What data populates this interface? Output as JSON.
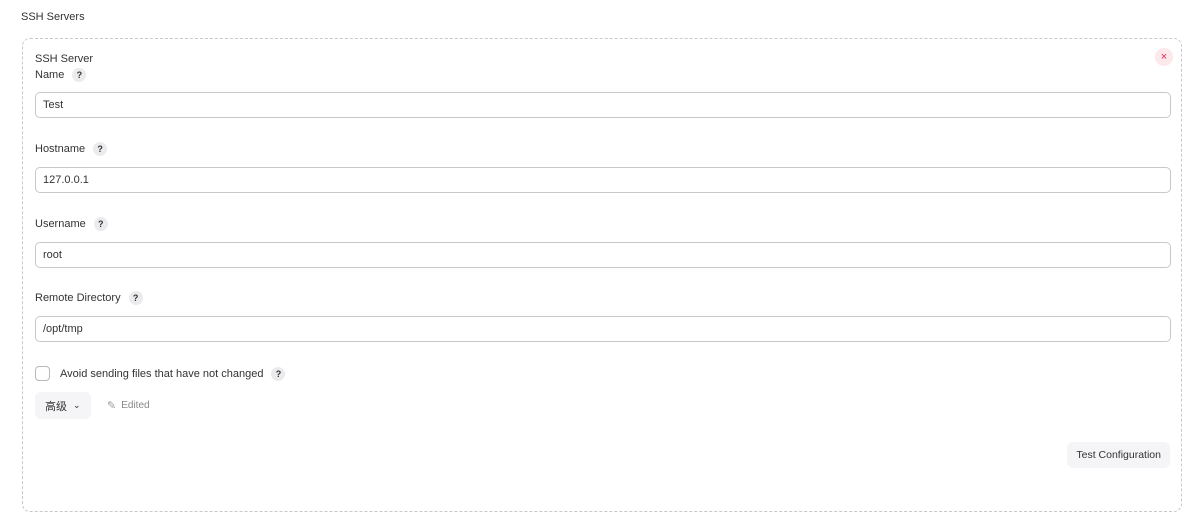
{
  "section_title": "SSH Servers",
  "card": {
    "title": "SSH Server",
    "close_icon": "×",
    "help_icon": "?",
    "fields": {
      "name": {
        "label": "Name",
        "value": "Test"
      },
      "hostname": {
        "label": "Hostname",
        "value": "127.0.0.1"
      },
      "username": {
        "label": "Username",
        "value": "root"
      },
      "remote_directory": {
        "label": "Remote Directory",
        "value": "/opt/tmp"
      }
    },
    "avoid_sending": {
      "label": "Avoid sending files that have not changed",
      "checked": false
    },
    "advanced_button": {
      "label": "高级",
      "chevron": "⌄"
    },
    "edited": {
      "icon": "✎",
      "label": "Edited"
    },
    "test_button": {
      "label": "Test Configuration"
    }
  },
  "colors": {
    "close_fg": "#e0284f",
    "close_bg": "#fde8ec",
    "border": "#c8c8cc"
  }
}
